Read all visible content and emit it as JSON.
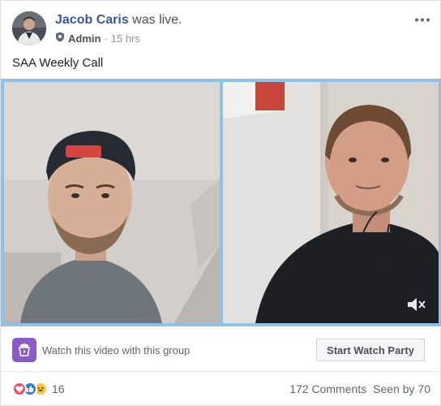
{
  "post": {
    "author": "Jacob Caris",
    "action": "was live.",
    "role": "Admin",
    "separator": "·",
    "time": "15 hrs",
    "text": "SAA Weekly Call"
  },
  "video": {
    "participants": 2,
    "muted": true
  },
  "watch_party": {
    "prompt": "Watch this video with this group",
    "button_label": "Start Watch Party"
  },
  "stats": {
    "reaction_count": "16",
    "reactions": [
      "love",
      "like",
      "haha"
    ],
    "comments": "172 Comments",
    "seen_by": "Seen by 70"
  },
  "icons": {
    "more": "more-options-icon",
    "role": "admin-shield-icon",
    "mute": "speaker-muted-icon",
    "watch_party": "watch-party-icon"
  },
  "colors": {
    "author_link": "#385898",
    "video_border": "#8ec1e6",
    "watch_party": "#8b5bc8",
    "love": "#f25268",
    "like": "#2a7de1",
    "haha": "#f7c946"
  }
}
